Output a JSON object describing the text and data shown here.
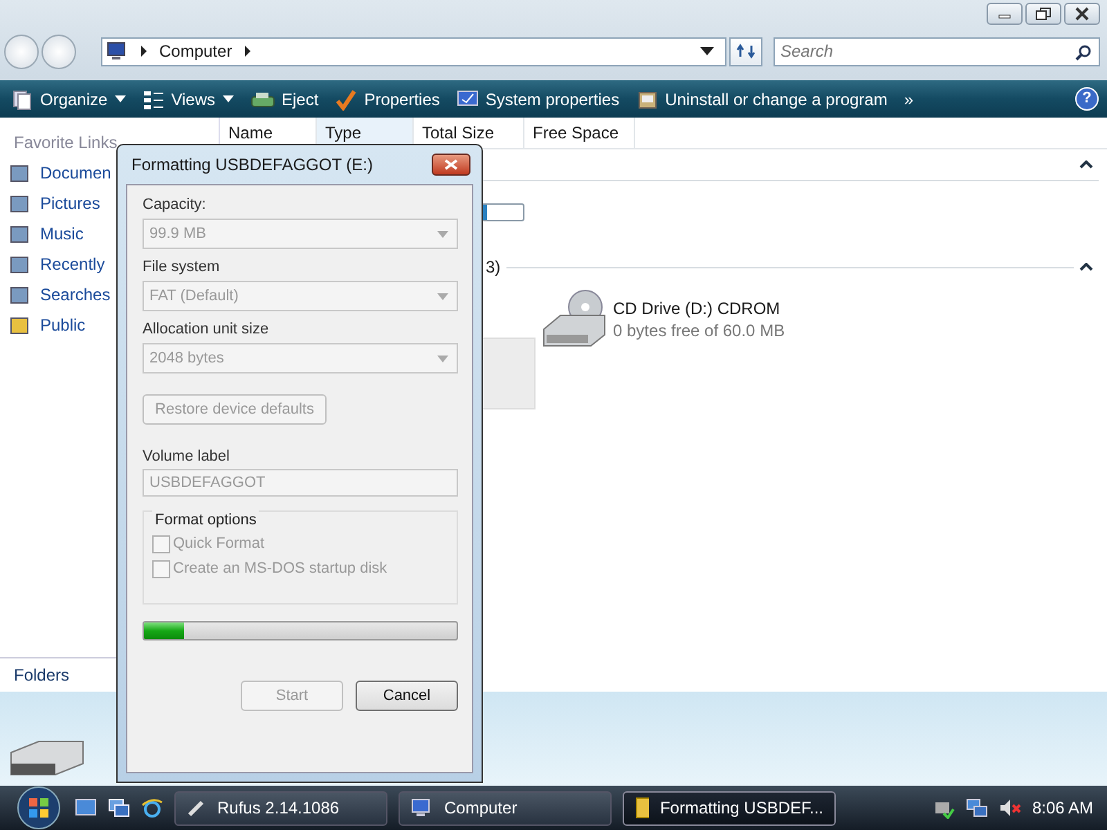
{
  "address_bar": {
    "path": [
      "Computer"
    ]
  },
  "search": {
    "placeholder": "Search"
  },
  "toolbar": {
    "items": [
      {
        "label": "Organize",
        "kind": "organize",
        "dropdown": true
      },
      {
        "label": "Views",
        "kind": "views",
        "dropdown": true
      },
      {
        "label": "Eject",
        "kind": "eject",
        "dropdown": false
      },
      {
        "label": "Properties",
        "kind": "properties",
        "dropdown": false
      },
      {
        "label": "System properties",
        "kind": "system",
        "dropdown": false
      },
      {
        "label": "Uninstall or change a program",
        "kind": "uninstall",
        "dropdown": false
      }
    ],
    "overflow": "»",
    "help": "?"
  },
  "sidebar": {
    "heading": "Favorite Links",
    "items": [
      {
        "label": "Documen"
      },
      {
        "label": "Pictures"
      },
      {
        "label": "Music"
      },
      {
        "label": "Recently"
      },
      {
        "label": "Searches"
      },
      {
        "label": "Public"
      }
    ],
    "footer": "Folders"
  },
  "columns": [
    {
      "label": "Name",
      "sorted": false
    },
    {
      "label": "Type",
      "sorted": true
    },
    {
      "label": "Total Size",
      "sorted": false
    },
    {
      "label": "Free Space",
      "sorted": false
    }
  ],
  "group_header_fragment": "3)",
  "drives": [
    {
      "name": "CD Drive (D:) CDROM",
      "detail": "0 bytes free of 60.0 MB"
    }
  ],
  "dialog": {
    "title": "Formatting USBDEFAGGOT (E:)",
    "fields": [
      {
        "label": "Capacity:",
        "value": "99.9 MB",
        "disabled": true
      },
      {
        "label": "File system",
        "value": "FAT (Default)",
        "disabled": true
      },
      {
        "label": "Allocation unit size",
        "value": "2048 bytes",
        "disabled": true
      }
    ],
    "restore_button": {
      "label": "Restore device defaults",
      "disabled": true
    },
    "volume_label": {
      "label": "Volume label",
      "value": "USBDEFAGGOT",
      "disabled": true
    },
    "format_options": {
      "title": "Format options",
      "options": [
        {
          "label": "Quick Format",
          "checked": false,
          "disabled": true
        },
        {
          "label": "Create an MS-DOS startup disk",
          "checked": false,
          "disabled": true
        }
      ]
    },
    "progress": {
      "level": 0.13
    },
    "buttons": [
      {
        "label": "Start",
        "disabled": true
      },
      {
        "label": "Cancel",
        "disabled": false
      }
    ]
  },
  "taskbar": {
    "buttons": [
      {
        "label": "Rufus 2.14.1086",
        "kind": "rufus",
        "selected": false
      },
      {
        "label": "Computer",
        "kind": "computer",
        "selected": false
      },
      {
        "label": "Formatting USBDEF...",
        "kind": "folder",
        "selected": true
      }
    ],
    "clock": "8:06 AM"
  }
}
